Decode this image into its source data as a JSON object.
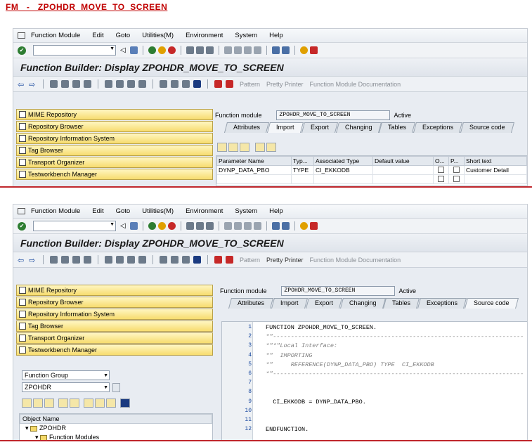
{
  "page_title": "FM   -   ZPOHDR  MOVE  TO  SCREEN",
  "menu": [
    "Function Module",
    "Edit",
    "Goto",
    "Utilities(M)",
    "Environment",
    "System",
    "Help"
  ],
  "heading": "Function Builder: Display ZPOHDR_MOVE_TO_SCREEN",
  "app_toolbar": {
    "pattern": "Pattern",
    "pretty_printer": "Pretty Printer",
    "fm_doc": "Function Module Documentation"
  },
  "nav_buttons": [
    "MIME Repository",
    "Repository Browser",
    "Repository Information System",
    "Tag Browser",
    "Transport Organizer",
    "Testworkbench Manager"
  ],
  "fm": {
    "label": "Function module",
    "value": "ZPOHDR_MOVE_TO_SCREEN",
    "status": "Active"
  },
  "tabs": [
    "Attributes",
    "Import",
    "Export",
    "Changing",
    "Tables",
    "Exceptions",
    "Source code"
  ],
  "import_grid": {
    "headers": [
      "Parameter Name",
      "Typ...",
      "Associated Type",
      "Default value",
      "O...",
      "P...",
      "Short text"
    ],
    "rows": [
      {
        "name": "DYNP_DATA_PBO",
        "typing": "TYPE",
        "assoc": "CI_EKKODB",
        "default": "",
        "short": "Customer Detail"
      }
    ]
  },
  "object_nav": {
    "type_select": "Function Group",
    "name_select": "ZPOHDR",
    "tree_header": "Object Name",
    "tree_root": "ZPOHDR",
    "tree_child": "Function Modules"
  },
  "source_lines": [
    {
      "num": "1",
      "text": "FUNCTION ZPOHDR_MOVE_TO_SCREEN.",
      "kind": "kw"
    },
    {
      "num": "2",
      "text": "*\"----------------------------------------------------------------------",
      "kind": "comment"
    },
    {
      "num": "3",
      "text": "*\"*\"Local Interface:",
      "kind": "comment"
    },
    {
      "num": "4",
      "text": "*\"  IMPORTING",
      "kind": "comment"
    },
    {
      "num": "5",
      "text": "*\"     REFERENCE(DYNP_DATA_PBO) TYPE  CI_EKKODB",
      "kind": "comment"
    },
    {
      "num": "6",
      "text": "*\"----------------------------------------------------------------------",
      "kind": "comment"
    },
    {
      "num": "7",
      "text": "",
      "kind": "kw"
    },
    {
      "num": "8",
      "text": "",
      "kind": "kw"
    },
    {
      "num": "9",
      "text": "  CI_EKKODB = DYNP_DATA_PBO.",
      "kind": "kw"
    },
    {
      "num": "10",
      "text": "",
      "kind": "kw"
    },
    {
      "num": "11",
      "text": "",
      "kind": "kw"
    },
    {
      "num": "12",
      "text": "ENDFUNCTION.",
      "kind": "kw"
    }
  ],
  "colors": {
    "accent_red": "#c00000",
    "nav_button_yellow": "#f7dc6e",
    "line_number_blue": "#1a4aa0"
  }
}
